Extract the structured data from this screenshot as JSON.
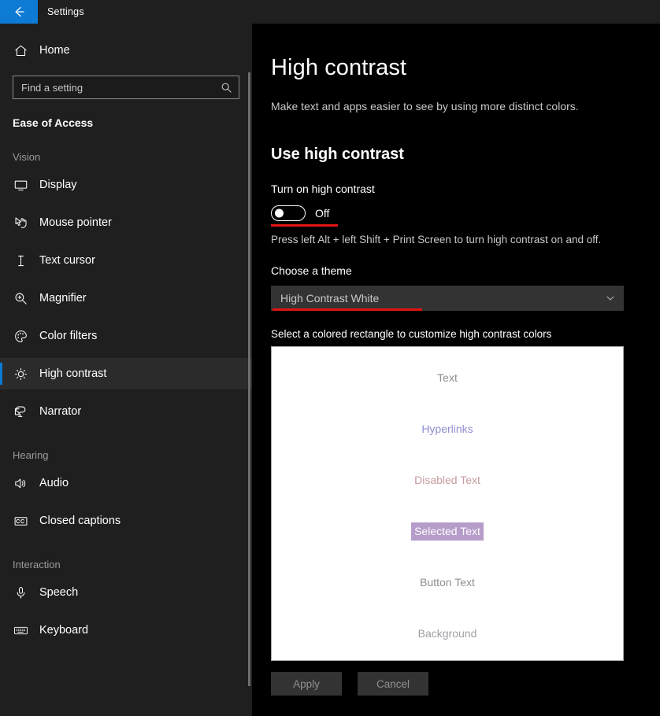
{
  "window": {
    "title": "Settings",
    "back_icon": "arrow-left-icon",
    "accent_color": "#0d7ad4"
  },
  "sidebar": {
    "home": {
      "label": "Home",
      "icon": "home-icon"
    },
    "search": {
      "placeholder": "Find a setting",
      "value": "",
      "icon": "search-icon"
    },
    "category": "Ease of Access",
    "groups": [
      {
        "label": "Vision",
        "items": [
          {
            "label": "Display",
            "icon": "monitor-icon",
            "active": false
          },
          {
            "label": "Mouse pointer",
            "icon": "mouse-pointer-icon",
            "active": false
          },
          {
            "label": "Text cursor",
            "icon": "text-cursor-icon",
            "active": false
          },
          {
            "label": "Magnifier",
            "icon": "magnifier-icon",
            "active": false
          },
          {
            "label": "Color filters",
            "icon": "palette-icon",
            "active": false
          },
          {
            "label": "High contrast",
            "icon": "sun-icon",
            "active": true
          },
          {
            "label": "Narrator",
            "icon": "narrator-icon",
            "active": false
          }
        ]
      },
      {
        "label": "Hearing",
        "items": [
          {
            "label": "Audio",
            "icon": "speaker-icon",
            "active": false
          },
          {
            "label": "Closed captions",
            "icon": "closed-captions-icon",
            "active": false
          }
        ]
      },
      {
        "label": "Interaction",
        "items": [
          {
            "label": "Speech",
            "icon": "microphone-icon",
            "active": false
          },
          {
            "label": "Keyboard",
            "icon": "keyboard-icon",
            "active": false
          }
        ]
      }
    ]
  },
  "main": {
    "page_title": "High contrast",
    "page_subtitle": "Make text and apps easier to see by using more distinct colors.",
    "section_title": "Use high contrast",
    "toggle": {
      "label": "Turn on high contrast",
      "state": "Off",
      "on": false
    },
    "hint": "Press left Alt + left Shift + Print Screen to turn high contrast on and off.",
    "theme": {
      "label": "Choose a theme",
      "selected": "High Contrast White",
      "chevron_icon": "chevron-down-icon"
    },
    "preview": {
      "caption": "Select a colored rectangle to customize high contrast colors",
      "background_color": "#ffffff",
      "items": [
        {
          "label": "Text",
          "color": "#8e8e93",
          "bg": "transparent"
        },
        {
          "label": "Hyperlinks",
          "color": "#8e8fd0",
          "bg": "transparent"
        },
        {
          "label": "Disabled Text",
          "color": "#c79ba0",
          "bg": "transparent"
        },
        {
          "label": "Selected Text",
          "color": "#ffffff",
          "bg": "#b59cc9"
        },
        {
          "label": "Button Text",
          "color": "#8e8e93",
          "bg": "transparent"
        },
        {
          "label": "Background",
          "color": "#a0a0a5",
          "bg": "transparent"
        }
      ]
    },
    "actions": {
      "apply_label": "Apply",
      "cancel_label": "Cancel"
    },
    "annotation_color": "#e21313"
  }
}
